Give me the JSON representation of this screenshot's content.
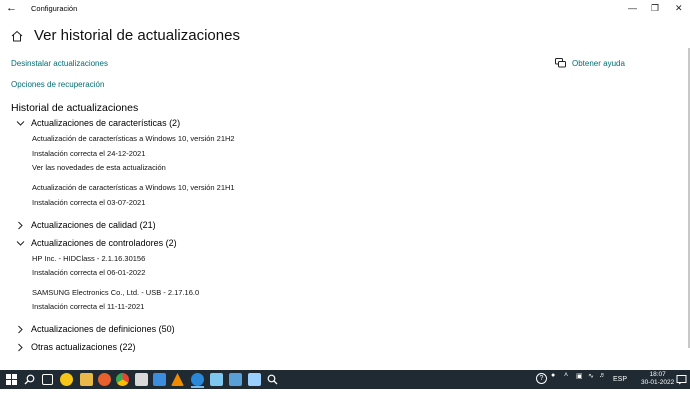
{
  "window": {
    "title": "Configuración"
  },
  "header": {
    "title": "Ver historial de actualizaciones"
  },
  "links": {
    "uninstall": "Desinstalar actualizaciones",
    "recovery": "Opciones de recuperación",
    "help": "Obtener ayuda"
  },
  "history": {
    "title": "Historial de actualizaciones",
    "groups": [
      {
        "label": "Actualizaciones de características (2)",
        "expanded": true,
        "items": [
          {
            "name": "Actualización de características a Windows 10, versión 21H2",
            "status": "Instalación correcta el 24-12-2021",
            "link": "Ver las novedades de esta actualización"
          },
          {
            "name": "Actualización de características a Windows 10, versión 21H1",
            "status": "Instalación correcta el 03-07-2021"
          }
        ]
      },
      {
        "label": "Actualizaciones de calidad (21)",
        "expanded": false
      },
      {
        "label": "Actualizaciones de controladores (2)",
        "expanded": true,
        "items": [
          {
            "name": "HP Inc. - HIDClass - 2.1.16.30156",
            "status": "Instalación correcta el 06-01-2022"
          },
          {
            "name": "SAMSUNG Electronics Co., Ltd.  - USB - 2.17.16.0",
            "status": "Instalación correcta el 11-11-2021"
          }
        ]
      },
      {
        "label": "Actualizaciones de definiciones (50)",
        "expanded": false
      },
      {
        "label": "Otras actualizaciones (22)",
        "expanded": false
      }
    ]
  },
  "taskbar": {
    "language": "ESP",
    "time": "18:07",
    "date": "30-01-2022",
    "apps": [
      "start",
      "search",
      "task-view",
      "norton",
      "file-explorer",
      "firefox",
      "chrome",
      "app-1",
      "app-2",
      "vlc",
      "settings",
      "app-3",
      "app-4",
      "app-5",
      "search-app"
    ]
  },
  "colors": {
    "link": "#006e74",
    "taskbar": "#1f2a33",
    "accent": "#76b9ed"
  }
}
